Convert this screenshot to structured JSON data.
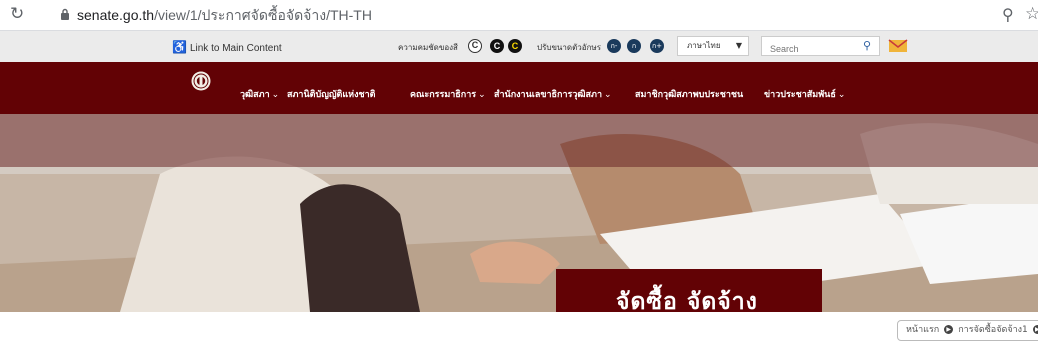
{
  "browser": {
    "url_domain": "senate.go.th",
    "url_path": "/view/1/ประกาศจัดซื้อจัดจ้าง/TH-TH",
    "reload_icon": "reload-icon",
    "zoom_icon": "zoom-icon",
    "star_icon": "star-icon"
  },
  "utility": {
    "skip_link": "Link to Main Content",
    "contrast_label": "ความคมชัดของสี",
    "contrast_buttons": [
      "C",
      "C",
      "C"
    ],
    "font_size_label": "ปรับขนาดตัวอักษร",
    "font_size_buttons": [
      "ก-",
      "ก",
      "ก+"
    ],
    "language_value": "ภาษาไทย",
    "search_placeholder": "Search"
  },
  "nav": {
    "items": [
      {
        "label": "วุฒิสภา",
        "has_dropdown": true
      },
      {
        "label": "สภานิติบัญญัติแห่งชาติ",
        "has_dropdown": false
      },
      {
        "label": "คณะกรรมาธิการ",
        "has_dropdown": true
      },
      {
        "label": "สำนักงานเลขาธิการวุฒิสภา",
        "has_dropdown": true
      },
      {
        "label": "สมาชิกวุฒิสภาพบประชาชน",
        "has_dropdown": false
      },
      {
        "label": "ข่าวประชาสัมพันธ์",
        "has_dropdown": true
      }
    ],
    "dropdown_marker": "⌄"
  },
  "hero": {
    "title": "จัดซื้อ จัดจ้าง"
  },
  "breadcrumb": {
    "items": [
      "หน้าแรก",
      "การจัดซื้อจัดจ้าง1"
    ]
  },
  "colors": {
    "brand": "#620205",
    "utility_bar": "#ebebeb",
    "font_button": "#1a3a5c"
  }
}
